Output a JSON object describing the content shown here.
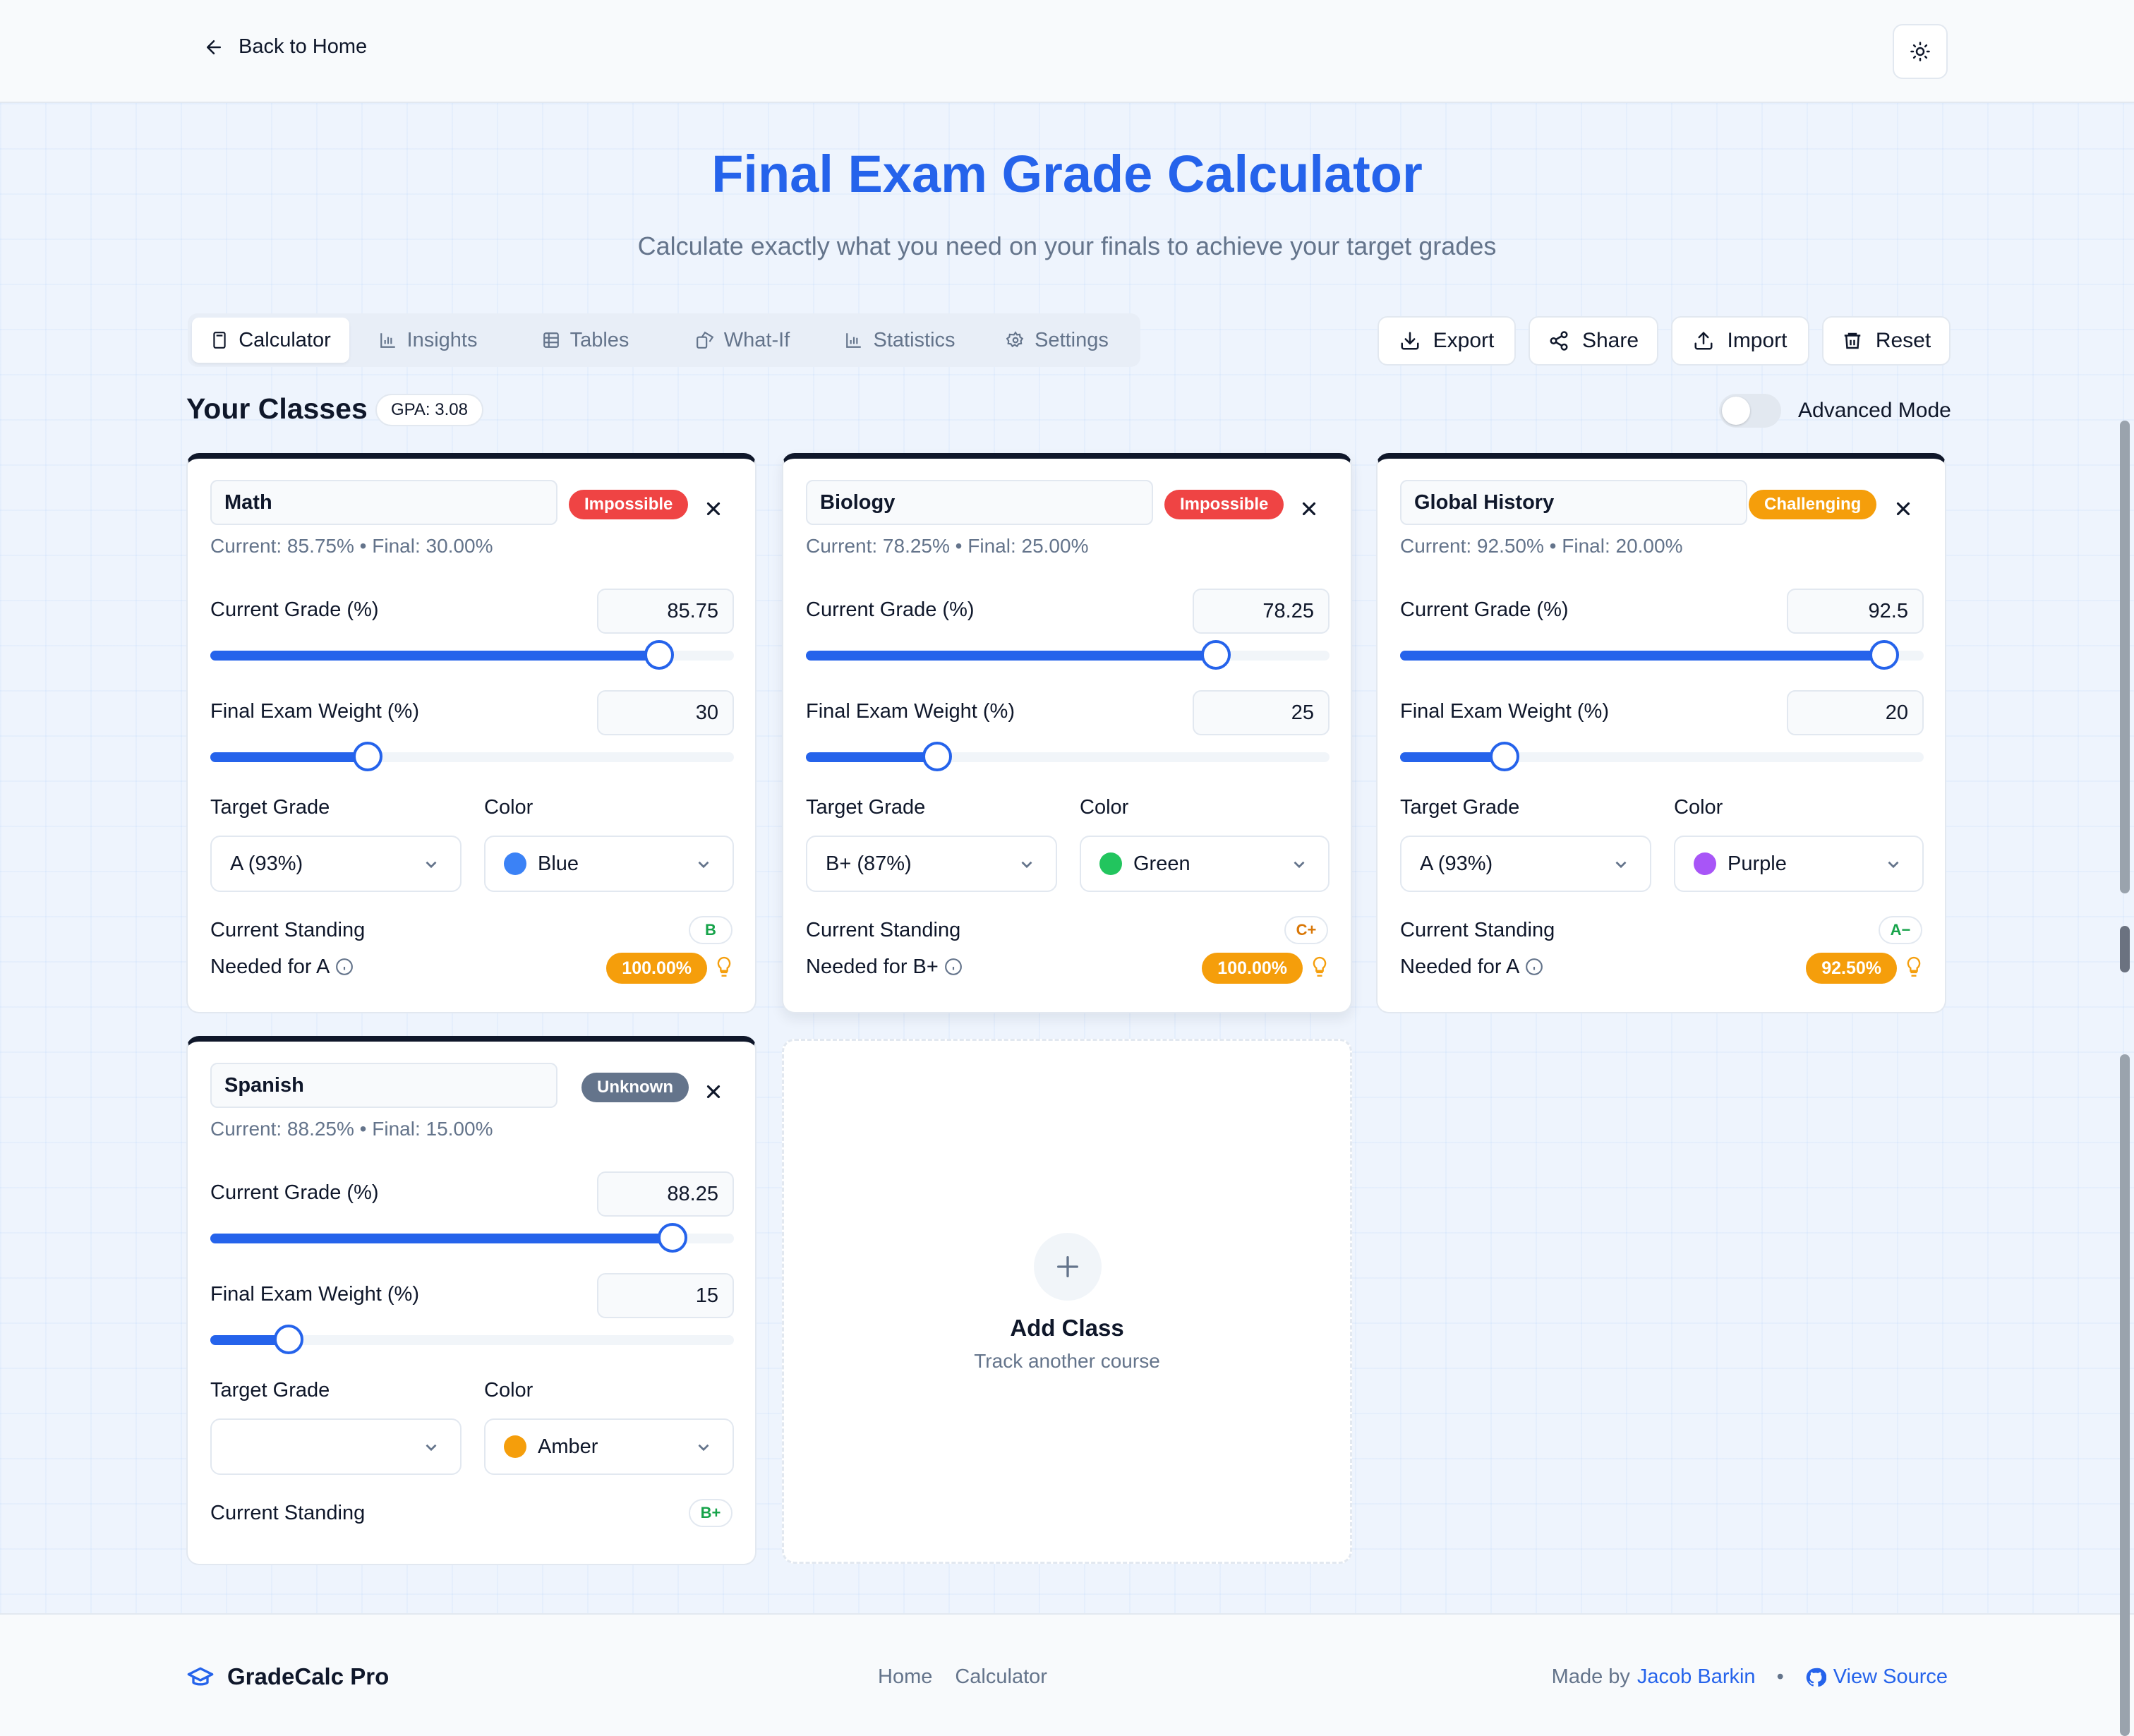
{
  "header": {
    "back_label": "Back to Home"
  },
  "hero": {
    "title": "Final Exam Grade Calculator",
    "subtitle": "Calculate exactly what you need on your finals to achieve your target grades"
  },
  "tabs": [
    {
      "label": "Calculator",
      "icon": "calculator-icon",
      "active": true
    },
    {
      "label": "Insights",
      "icon": "bar-chart-icon"
    },
    {
      "label": "Tables",
      "icon": "table-icon"
    },
    {
      "label": "What-If",
      "icon": "dice-icon"
    },
    {
      "label": "Statistics",
      "icon": "bar-chart-icon"
    },
    {
      "label": "Settings",
      "icon": "gear-icon"
    }
  ],
  "actions": {
    "export": "Export",
    "share": "Share",
    "import": "Import",
    "reset": "Reset"
  },
  "classes_section": {
    "title": "Your Classes",
    "gpa": "GPA: 3.08",
    "advanced_mode": "Advanced Mode",
    "advanced_on": false
  },
  "labels": {
    "current_grade": "Current Grade (%)",
    "final_weight": "Final Exam Weight (%)",
    "target_grade": "Target Grade",
    "color": "Color",
    "current_standing": "Current Standing"
  },
  "classes": [
    {
      "name": "Math",
      "status": "Impossible",
      "status_color": "#ef4444",
      "summary": "Current: 85.75%  •  Final: 30.00%",
      "current_grade": "85.75",
      "current_grade_fraction": 0.8575,
      "final_weight": "30",
      "final_weight_fraction": 0.3,
      "target": "A (93%)",
      "color_name": "Blue",
      "color_hex": "#3b82f6",
      "standing": "B",
      "standing_color": "#16a34a",
      "needed_label": "Needed for A",
      "needed": "100.00%"
    },
    {
      "name": "Biology",
      "status": "Impossible",
      "status_color": "#ef4444",
      "summary": "Current: 78.25%  •  Final: 25.00%",
      "current_grade": "78.25",
      "current_grade_fraction": 0.7825,
      "final_weight": "25",
      "final_weight_fraction": 0.25,
      "target": "B+ (87%)",
      "color_name": "Green",
      "color_hex": "#22c55e",
      "standing": "C+",
      "standing_color": "#d97706",
      "needed_label": "Needed for B+",
      "needed": "100.00%"
    },
    {
      "name": "Global History",
      "status": "Challenging",
      "status_color": "#f59e0b",
      "summary": "Current: 92.50%  •  Final: 20.00%",
      "current_grade": "92.5",
      "current_grade_fraction": 0.925,
      "final_weight": "20",
      "final_weight_fraction": 0.2,
      "target": "A (93%)",
      "color_name": "Purple",
      "color_hex": "#a855f7",
      "standing": "A−",
      "standing_color": "#16a34a",
      "needed_label": "Needed for A",
      "needed": "92.50%"
    },
    {
      "name": "Spanish",
      "status": "Unknown",
      "status_color": "#64748b",
      "summary": "Current: 88.25%  •  Final: 15.00%",
      "current_grade": "88.25",
      "current_grade_fraction": 0.8825,
      "final_weight": "15",
      "final_weight_fraction": 0.15,
      "target": "",
      "color_name": "Amber",
      "color_hex": "#f59e0b",
      "standing": "B+",
      "standing_color": "#16a34a"
    }
  ],
  "add_class": {
    "title": "Add Class",
    "subtitle": "Track another course"
  },
  "footer": {
    "brand": "GradeCalc Pro",
    "nav": [
      "Home",
      "Calculator"
    ],
    "made_by": "Made by",
    "author": "Jacob Barkin",
    "view_source": "View Source"
  }
}
